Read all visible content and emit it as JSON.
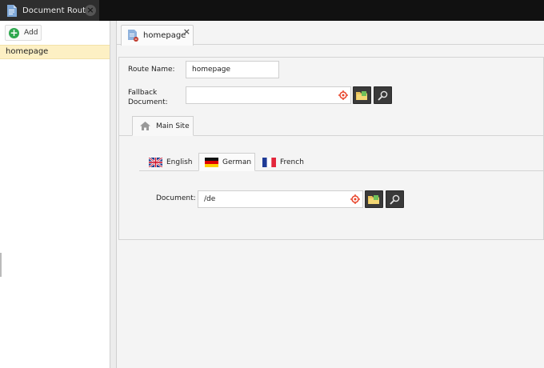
{
  "window": {
    "tab_title": "Document Route"
  },
  "sidebar": {
    "add_label": "Add",
    "items": [
      {
        "label": "homepage",
        "selected": true
      }
    ]
  },
  "editor": {
    "tab_label": "homepage",
    "close_glyph": "×",
    "route_name_label": "Route Name:",
    "route_name_value": "homepage",
    "fallback_label_line1": "Fallback",
    "fallback_label_line2": "Document:",
    "fallback_value": "",
    "site_tabs": [
      {
        "label": "Main Site",
        "icon": "home-icon"
      }
    ],
    "language_tabs": [
      {
        "label": "English",
        "icon": "uk-flag-icon",
        "active": false
      },
      {
        "label": "German",
        "icon": "germany-flag-icon",
        "active": true
      },
      {
        "label": "French",
        "icon": "france-flag-icon",
        "active": false
      }
    ],
    "document_label": "Document:",
    "document_value": "/de"
  },
  "colors": {
    "selected_row": "#fdf0c4",
    "add_green": "#2fa84f",
    "target_red": "#e8442a",
    "topbar": "#111111"
  }
}
